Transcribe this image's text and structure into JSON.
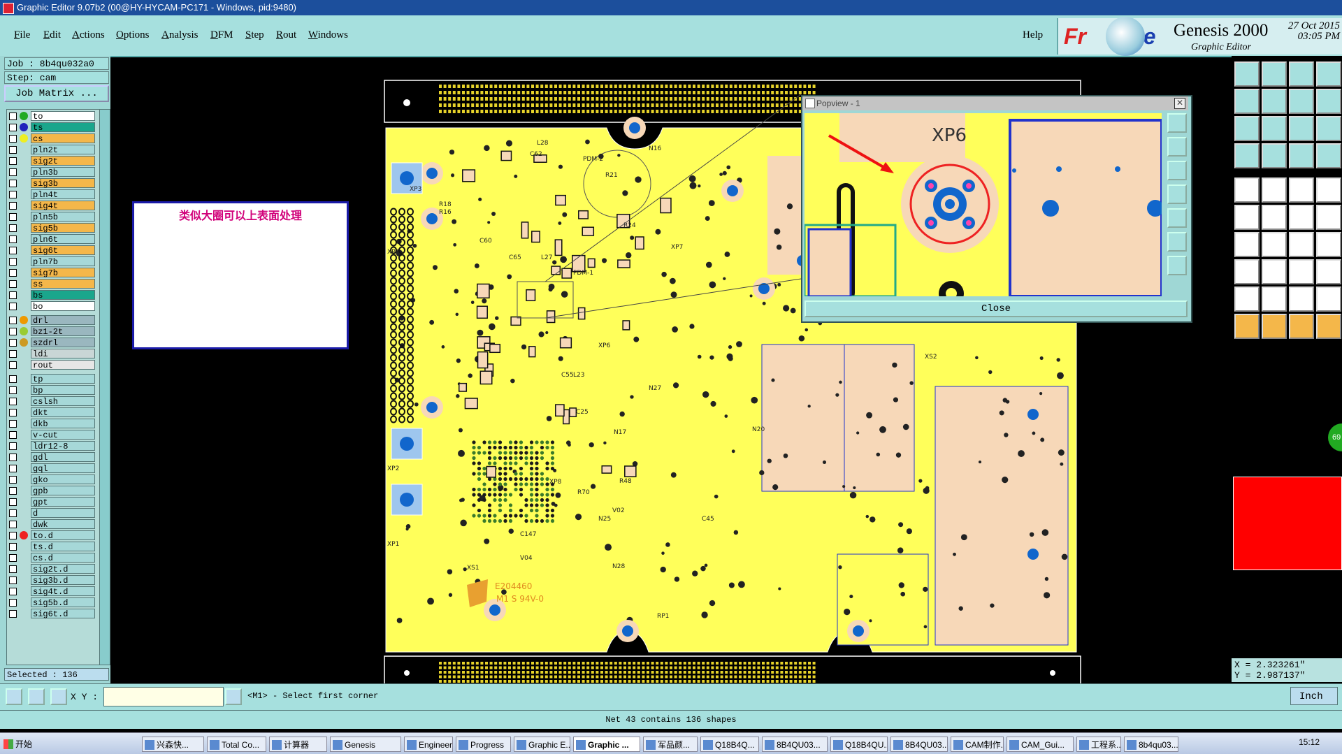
{
  "window": {
    "title": "Graphic Editor 9.07b2 (00@HY-HYCAM-PC171 - Windows, pid:9480)"
  },
  "menu": {
    "items": [
      "File",
      "Edit",
      "Actions",
      "Options",
      "Analysis",
      "DFM",
      "Step",
      "Rout",
      "Windows"
    ],
    "help": "Help"
  },
  "brand": {
    "logo_left": "Fr",
    "logo_right": "ine",
    "product": "Genesis 2000",
    "subtitle": "Graphic Editor",
    "date": "27 Oct 2015",
    "time": "03:05 PM"
  },
  "job": {
    "job_line": "Job : 8b4qu032a0",
    "step_line": "Step: cam",
    "matrix_button": "Job Matrix ..."
  },
  "layers": [
    {
      "name": "to",
      "color": "#ffffff",
      "dot": "#2a2"
    },
    {
      "name": "ts",
      "color": "#1aa68c",
      "dot": "#22b"
    },
    {
      "name": "cs",
      "color": "#f4b74a",
      "dot": "#ee2"
    },
    {
      "name": "pln2t",
      "color": "#a6d8d8",
      "dot": ""
    },
    {
      "name": "sig2t",
      "color": "#f4b74a",
      "dot": ""
    },
    {
      "name": "pln3b",
      "color": "#a6d8d8",
      "dot": ""
    },
    {
      "name": "sig3b",
      "color": "#f4b74a",
      "dot": ""
    },
    {
      "name": "pln4t",
      "color": "#a6d8d8",
      "dot": ""
    },
    {
      "name": "sig4t",
      "color": "#f4b74a",
      "dot": ""
    },
    {
      "name": "pln5b",
      "color": "#a6d8d8",
      "dot": ""
    },
    {
      "name": "sig5b",
      "color": "#f4b74a",
      "dot": ""
    },
    {
      "name": "pln6t",
      "color": "#a6d8d8",
      "dot": ""
    },
    {
      "name": "sig6t",
      "color": "#f4b74a",
      "dot": ""
    },
    {
      "name": "pln7b",
      "color": "#a6d8d8",
      "dot": ""
    },
    {
      "name": "sig7b",
      "color": "#f4b74a",
      "dot": ""
    },
    {
      "name": "ss",
      "color": "#f4b74a",
      "dot": ""
    },
    {
      "name": "bs",
      "color": "#1aa68c",
      "dot": ""
    },
    {
      "name": "bo",
      "color": "#ffffff",
      "dot": ""
    },
    {
      "name": "drl",
      "color": "#9ab7bf",
      "dot": "#e90"
    },
    {
      "name": "bz1-2t",
      "color": "#9ab7bf",
      "dot": "#9c3"
    },
    {
      "name": "szdrl",
      "color": "#9ab7bf",
      "dot": "#c92"
    },
    {
      "name": "ldi",
      "color": "#c9d6d6",
      "dot": ""
    },
    {
      "name": "rout",
      "color": "#e6e6e6",
      "dot": ""
    },
    {
      "name": "tp",
      "color": "#a6d8d8",
      "dot": ""
    },
    {
      "name": "bp",
      "color": "#a6d8d8",
      "dot": ""
    },
    {
      "name": "cslsh",
      "color": "#a6d8d8",
      "dot": ""
    },
    {
      "name": "dkt",
      "color": "#a6d8d8",
      "dot": ""
    },
    {
      "name": "dkb",
      "color": "#a6d8d8",
      "dot": ""
    },
    {
      "name": "v-cut",
      "color": "#a6d8d8",
      "dot": ""
    },
    {
      "name": "ldr12-8",
      "color": "#a6d8d8",
      "dot": ""
    },
    {
      "name": "gdl",
      "color": "#a6d8d8",
      "dot": ""
    },
    {
      "name": "gql",
      "color": "#a6d8d8",
      "dot": ""
    },
    {
      "name": "gko",
      "color": "#a6d8d8",
      "dot": ""
    },
    {
      "name": "gpb",
      "color": "#a6d8d8",
      "dot": ""
    },
    {
      "name": "gpt",
      "color": "#a6d8d8",
      "dot": ""
    },
    {
      "name": "d",
      "color": "#a6d8d8",
      "dot": ""
    },
    {
      "name": "dwk",
      "color": "#a6d8d8",
      "dot": ""
    },
    {
      "name": "to.d",
      "color": "#a6d8d8",
      "dot": "#e22"
    },
    {
      "name": "ts.d",
      "color": "#a6d8d8",
      "dot": ""
    },
    {
      "name": "cs.d",
      "color": "#a6d8d8",
      "dot": ""
    },
    {
      "name": "sig2t.d",
      "color": "#a6d8d8",
      "dot": ""
    },
    {
      "name": "sig3b.d",
      "color": "#a6d8d8",
      "dot": ""
    },
    {
      "name": "sig4t.d",
      "color": "#a6d8d8",
      "dot": ""
    },
    {
      "name": "sig5b.d",
      "color": "#a6d8d8",
      "dot": ""
    },
    {
      "name": "sig6t.d",
      "color": "#a6d8d8",
      "dot": ""
    }
  ],
  "selected_text": "Selected : 136",
  "annotation": "类似大圈可以上表面处理",
  "board": {
    "designators": [
      "XP3",
      "XP4",
      "XP2",
      "XP1",
      "XP6",
      "XP7",
      "XP8",
      "XS1",
      "XS2",
      "RP1",
      "N20",
      "N27",
      "N17",
      "N16",
      "N25",
      "N28",
      "V02",
      "V04",
      "R18",
      "R16",
      "R21",
      "R24",
      "R70",
      "R48",
      "C55",
      "C60",
      "C62",
      "C65",
      "C45",
      "C25",
      "C147",
      "L23",
      "L27",
      "L28",
      "PDM-1",
      "PDM-2",
      "E204460",
      "M1 S 94V-0"
    ]
  },
  "popview": {
    "title": "Popview - 1",
    "label": "XP6",
    "close": "Close"
  },
  "coords": {
    "x": "X = 2.323261\"",
    "y": "Y = 2.987137\""
  },
  "thumb_badge": "69",
  "command": {
    "xy_label": "X Y :",
    "prompt": "<M1> - Select first corner",
    "units": "Inch"
  },
  "status": "Net 43 contains 136 shapes",
  "taskbar": {
    "start": "开始",
    "tasks": [
      "兴森快...",
      "Total Co...",
      "计算器",
      "Genesis",
      "Engineeri...",
      "Progress",
      "Graphic E...",
      "Graphic ...",
      "军品颜...",
      "Q18B4Q...",
      "8B4QU03...",
      "Q18B4QU...",
      "8B4QU03...",
      "CAM制作...",
      "CAM_Gui...",
      "工程系...",
      "8b4qu03..."
    ],
    "active_index": 7,
    "clock": "15:12"
  }
}
